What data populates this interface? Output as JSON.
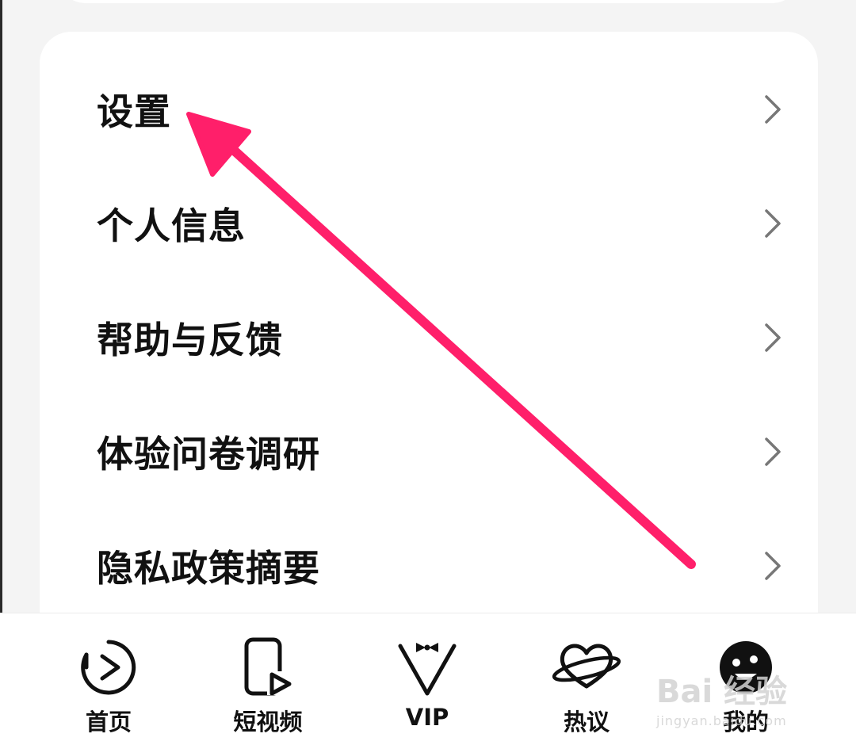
{
  "menu": {
    "items": [
      {
        "label": "设置"
      },
      {
        "label": "个人信息"
      },
      {
        "label": "帮助与反馈"
      },
      {
        "label": "体验问卷调研"
      },
      {
        "label": "隐私政策摘要"
      }
    ]
  },
  "tabbar": {
    "tabs": [
      {
        "label": "首页",
        "icon": "play-circle-icon"
      },
      {
        "label": "短视频",
        "icon": "phone-play-icon"
      },
      {
        "label": "VIP",
        "icon": "vip-bowtie-icon"
      },
      {
        "label": "热议",
        "icon": "heart-planet-icon"
      },
      {
        "label": "我的",
        "icon": "avatar-icon"
      }
    ]
  },
  "annotation": {
    "color": "#ff1f6a"
  },
  "watermark": {
    "brand": "Bai 经验",
    "url": "jingyan.baidu.com"
  }
}
